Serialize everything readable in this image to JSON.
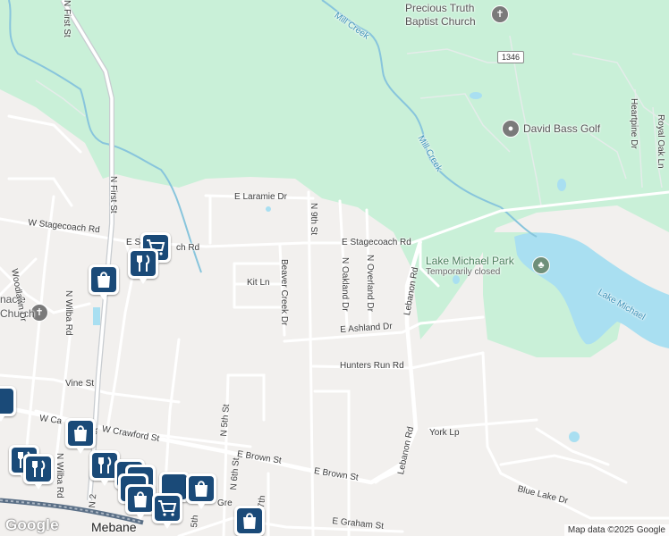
{
  "map": {
    "streets": {
      "n_first_st": "N First St",
      "n_first_st_top": "N First St",
      "w_stagecoach_rd": "W Stagecoach Rd",
      "e_stagecoach_rd_west": "E Stagecoach Rd",
      "e_stagecoach_rd": "E Stagecoach Rd",
      "e_laramie_dr": "E Laramie Dr",
      "n_9th_st": "N 9th St",
      "beaver_creek_dr": "Beaver Creek Dr",
      "kit_ln": "Kit Ln",
      "n_oakland_dr": "N Oakland Dr",
      "n_overland_dr": "N Overland Dr",
      "e_ashland_dr": "E Ashland Dr",
      "hunters_run_rd": "Hunters Run Rd",
      "lebanon_rd_top": "Lebanon Rd",
      "lebanon_rd_bottom": "Lebanon Rd",
      "york_lp": "York Lp",
      "e_brown_st_1": "E Brown St",
      "e_brown_st_2": "E Brown St",
      "e_graham_st": "E Graham St",
      "blue_lake_dr": "Blue Lake Dr",
      "vine_st": "Vine St",
      "w_crawford_st": "W Crawford St",
      "w_ca": "W Ca",
      "n_wilba_rd": "N Wilba Rd",
      "n_wilba_rd_2": "N Wilba Rd",
      "n_5th_st": "N 5th St",
      "n_6th_st": "N 6th St",
      "woodlawn_dr": "Woodlawn Dr",
      "heartpine_dr": "Heartpine Dr",
      "royal_oak_ln": "Royal Oak Ln",
      "n_2": "N 2",
      "st_fragment": "st",
      "n_5th_fragment": "5th",
      "n_7th_fragment": "7th",
      "gre_fragment": "Gre",
      "ch_rd_fragment": "ch Rd",
      "e_s_fragment": "E S"
    },
    "water": {
      "mill_creek_top": "Mill Creek",
      "mill_creek_mid": "Mill Creek",
      "lake_michael": "Lake Michael"
    },
    "pois": {
      "church_name_1": "Precious Truth",
      "church_name_2": "Baptist Church",
      "golf": "David Bass Golf",
      "park": "Lake Michael Park",
      "park_status": "Temporarily closed",
      "tabernacle_1": "nacle",
      "tabernacle_2": "Church"
    },
    "route_shield": "1346",
    "city": "Mebane",
    "attribution": "Map data ©2025 Google",
    "logo": "Google"
  }
}
